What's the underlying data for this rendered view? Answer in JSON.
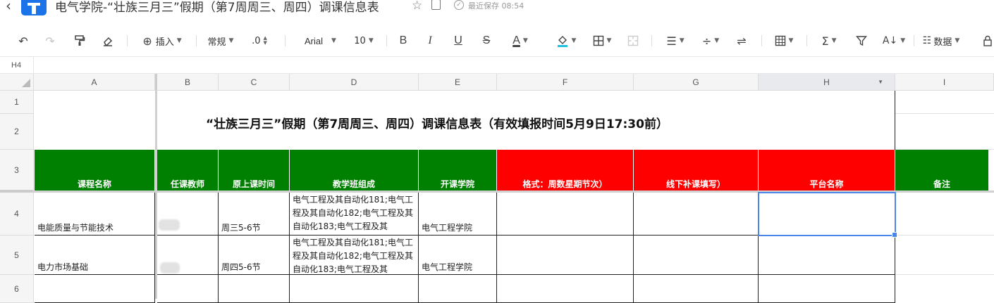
{
  "titlebar": {
    "back": "‹",
    "title": "电气学院-“壮族三月三”假期（第7周周三、周四）调课信息表",
    "saved": "最近保存 08:54"
  },
  "toolbar": {
    "insert": "插入",
    "format": "常规",
    "decimal": ".0",
    "font": "Arial",
    "size": "10",
    "bold": "B",
    "italic": "I",
    "underline": "U",
    "strike": "S",
    "fontcolor": "A",
    "data": "数据"
  },
  "formula": {
    "cellref": "H4"
  },
  "columns": [
    "A",
    "B",
    "C",
    "D",
    "E",
    "F",
    "G",
    "H",
    "I"
  ],
  "rows": [
    "1",
    "2",
    "3",
    "4",
    "5",
    "6"
  ],
  "sheet": {
    "title": "“壮族三月三”假期（第7周周三、周四）调课信息表（有效填报时间5月9日17:30前）",
    "headers": [
      "课程名称",
      "任课教师",
      "原上课时间",
      "教学班组成",
      "开课学院",
      "格式：周数星期节次）",
      "线下补课填写）",
      "平台名称",
      "备注"
    ],
    "rows": [
      {
        "course": "电能质量与节能技术",
        "time": "周三5-6节",
        "classes": "电气工程及其自动化181;电气工程及其自动化182;电气工程及其自动化183;电气工程及其",
        "college": "电气工程学院"
      },
      {
        "course": "电力市场基础",
        "time": "周四5-6节",
        "classes": "电气工程及其自动化181;电气工程及其自动化182;电气工程及其自动化183;电气工程及其",
        "college": "电气工程学院"
      }
    ]
  },
  "colors": {
    "green": "#008000",
    "red": "#FF0000",
    "select": "#4A86E8"
  }
}
